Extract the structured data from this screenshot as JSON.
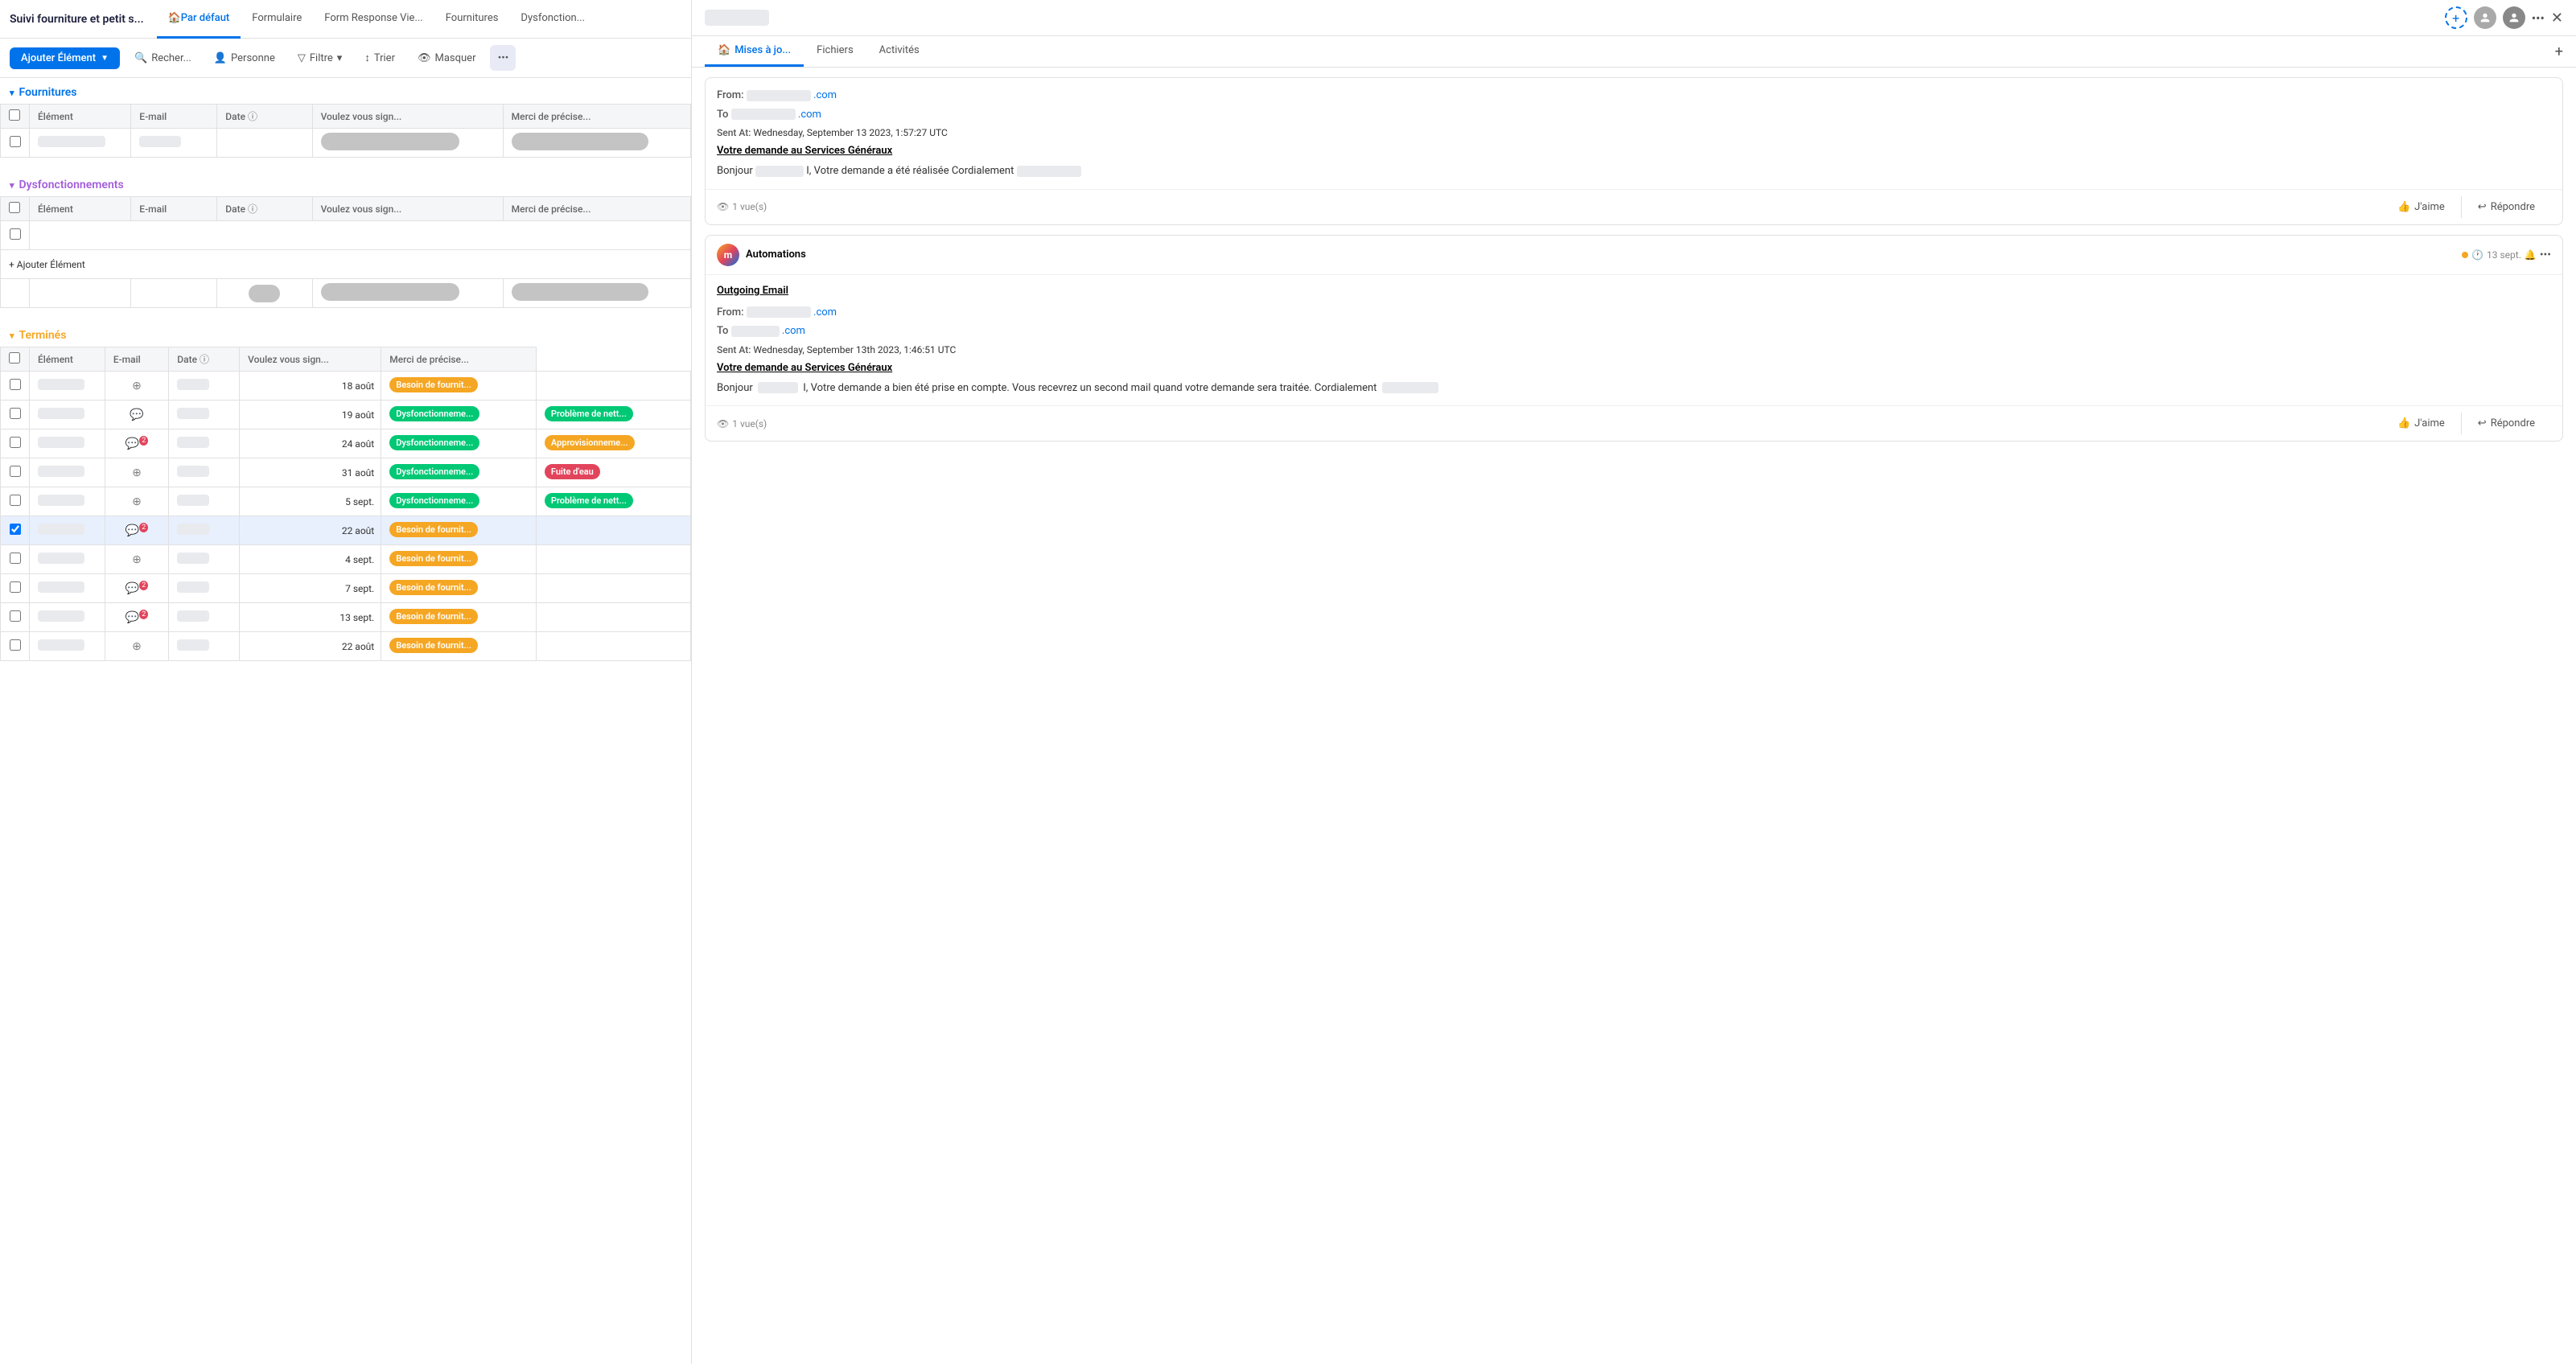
{
  "app": {
    "title": "Suivi fourniture et petit s...",
    "tabs": [
      {
        "label": "Par défaut",
        "active": true,
        "icon": "home"
      },
      {
        "label": "Formulaire",
        "active": false
      },
      {
        "label": "Form Response Vie...",
        "active": false
      },
      {
        "label": "Fournitures",
        "active": false
      },
      {
        "label": "Dysfonction...",
        "active": false
      }
    ]
  },
  "toolbar": {
    "add_label": "Ajouter Élément",
    "search_label": "Recher...",
    "person_label": "Personne",
    "filter_label": "Filtre",
    "sort_label": "Trier",
    "hide_label": "Masquer"
  },
  "sections": {
    "fournitures": {
      "label": "Fournitures",
      "columns": [
        "Élément",
        "E-mail",
        "Date",
        "Voulez vous sign...",
        "Merci de précise..."
      ],
      "rows": []
    },
    "dysfonctionnements": {
      "label": "Dysfonctionnements",
      "columns": [
        "Élément",
        "E-mail",
        "Date",
        "Voulez vous sign...",
        "Merci de précise..."
      ],
      "rows": [],
      "add_row": "+ Ajouter Élément"
    },
    "termines": {
      "label": "Terminés",
      "columns": [
        "Élément",
        "E-mail",
        "Date",
        "Voulez vous sign...",
        "Merci de précise..."
      ],
      "rows": [
        {
          "date": "18 août",
          "badge1": "Besoin de fournit...",
          "badge1_color": "orange",
          "badge2": "",
          "badge2_color": "",
          "icon": "plus",
          "selected": false
        },
        {
          "date": "19 août",
          "badge1": "Dysfonctionneme...",
          "badge1_color": "green",
          "badge2": "Problème de nett...",
          "badge2_color": "green",
          "icon": "chat",
          "selected": false
        },
        {
          "date": "24 août",
          "badge1": "Dysfonctionneme...",
          "badge1_color": "green",
          "badge2": "Approvisionneme...",
          "badge2_color": "orange",
          "icon": "chat2",
          "selected": false
        },
        {
          "date": "31 août",
          "badge1": "Dysfonctionneme...",
          "badge1_color": "green",
          "badge2": "Fuite d'eau",
          "badge2_color": "red",
          "icon": "plus",
          "selected": false
        },
        {
          "date": "5 sept.",
          "badge1": "Dysfonctionneme...",
          "badge1_color": "green",
          "badge2": "Problème de nett...",
          "badge2_color": "green",
          "icon": "plus",
          "selected": false
        },
        {
          "date": "22 août",
          "badge1": "Besoin de fournit...",
          "badge1_color": "orange",
          "badge2": "",
          "badge2_color": "",
          "icon": "chat2",
          "selected": true
        },
        {
          "date": "4 sept.",
          "badge1": "Besoin de fournit...",
          "badge1_color": "orange",
          "badge2": "",
          "badge2_color": "",
          "icon": "plus",
          "selected": false
        },
        {
          "date": "7 sept.",
          "badge1": "Besoin de fournit...",
          "badge1_color": "orange",
          "badge2": "",
          "badge2_color": "",
          "icon": "chat2",
          "selected": false
        },
        {
          "date": "13 sept.",
          "badge1": "Besoin de fournit...",
          "badge1_color": "orange",
          "badge2": "",
          "badge2_color": "",
          "icon": "chat2",
          "selected": false
        },
        {
          "date": "22 août",
          "badge1": "Besoin de fournit...",
          "badge1_color": "orange",
          "badge2": "",
          "badge2_color": "",
          "icon": "plus",
          "selected": false
        }
      ]
    }
  },
  "right_panel": {
    "tabs": [
      {
        "label": "Mises à jo...",
        "active": true,
        "icon": "home"
      },
      {
        "label": "Fichiers",
        "active": false
      },
      {
        "label": "Activités",
        "active": false
      }
    ],
    "add_tab": "+",
    "email_card_1": {
      "from_label": "From:",
      "from_value": ".com",
      "to_label": "To",
      "to_value": ".com",
      "sent_label": "Sent At:",
      "sent_value": "Wednesday, September 13 2023, 1:57:27 UTC",
      "subject": "Votre demande au Services Généraux",
      "body_text": "Bonjour",
      "body_middle": "I, Votre demande a été réalisée Cordialement",
      "views": "1 vue(s)",
      "like_label": "J'aime",
      "reply_label": "Répondre"
    },
    "automation_card": {
      "name": "Automations",
      "time": "13 sept.",
      "outgoing_label": "Outgoing Email",
      "from_label": "From:",
      "from_value": ".com",
      "to_label": "To",
      "to_value": ".com",
      "sent_label": "Sent At:",
      "sent_value": "Wednesday, September 13th 2023, 1:46:51 UTC",
      "subject": "Votre demande au Services Généraux",
      "body_text": "Bonjour",
      "body_text2": "I, Votre demande a bien été prise en compte. Vous recevrez un second mail quand votre demande sera traitée. Cordialement",
      "views": "1 vue(s)",
      "like_label": "J'aime",
      "reply_label": "Répondre"
    }
  }
}
